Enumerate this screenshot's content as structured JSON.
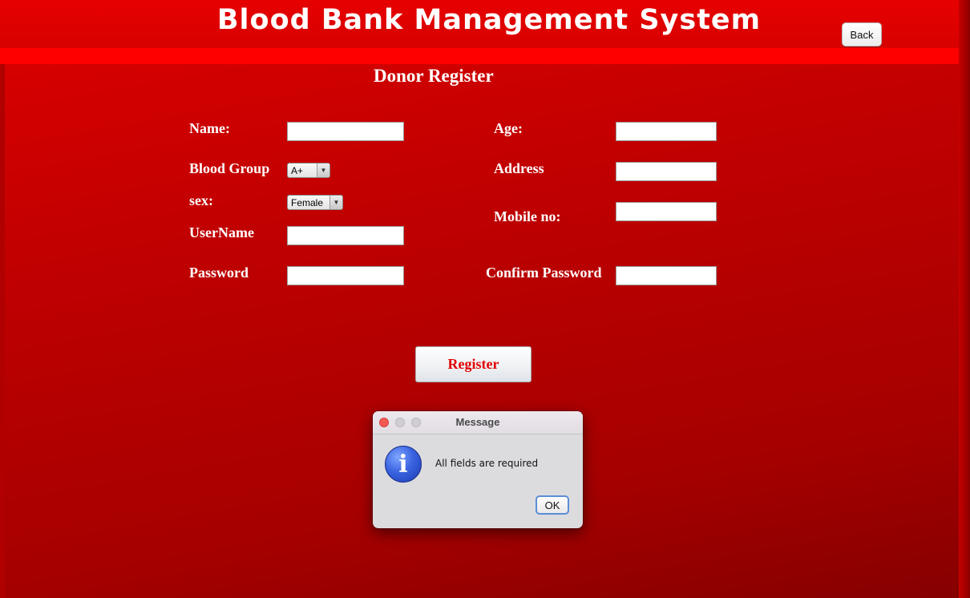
{
  "header": {
    "title": "Blood Bank Management System",
    "back_label": "Back"
  },
  "form": {
    "title": "Donor Register",
    "labels": {
      "name": "Name:",
      "blood_group": "Blood Group",
      "sex": "sex:",
      "username": "UserName",
      "password": "Password",
      "age": "Age:",
      "address": "Address",
      "mobile": "Mobile no:",
      "confirm_password": "Confirm Password"
    },
    "values": {
      "name": "",
      "username": "",
      "password": "",
      "age": "",
      "address": "",
      "mobile": "",
      "confirm_password": ""
    },
    "blood_group_selected": "A+",
    "sex_selected": "Female",
    "register_label": "Register"
  },
  "dialog": {
    "title": "Message",
    "message": "All fields are required",
    "ok_label": "OK",
    "icon": "info-icon"
  },
  "colors": {
    "background_red": "#c00000",
    "header_red": "#e00000",
    "register_text": "#e00000"
  }
}
